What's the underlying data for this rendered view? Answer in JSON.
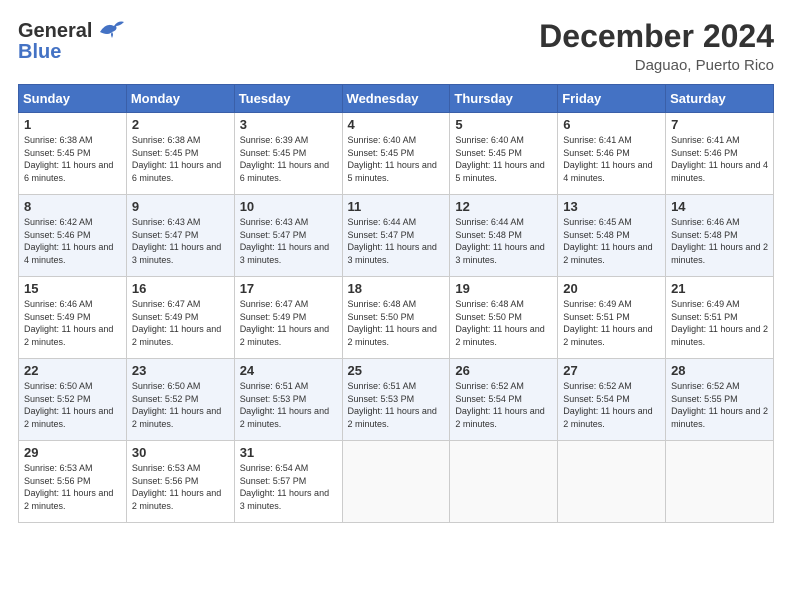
{
  "header": {
    "logo_general": "General",
    "logo_blue": "Blue",
    "month": "December 2024",
    "location": "Daguao, Puerto Rico"
  },
  "days_of_week": [
    "Sunday",
    "Monday",
    "Tuesday",
    "Wednesday",
    "Thursday",
    "Friday",
    "Saturday"
  ],
  "weeks": [
    [
      {
        "day": "1",
        "sunrise": "Sunrise: 6:38 AM",
        "sunset": "Sunset: 5:45 PM",
        "daylight": "Daylight: 11 hours and 6 minutes."
      },
      {
        "day": "2",
        "sunrise": "Sunrise: 6:38 AM",
        "sunset": "Sunset: 5:45 PM",
        "daylight": "Daylight: 11 hours and 6 minutes."
      },
      {
        "day": "3",
        "sunrise": "Sunrise: 6:39 AM",
        "sunset": "Sunset: 5:45 PM",
        "daylight": "Daylight: 11 hours and 6 minutes."
      },
      {
        "day": "4",
        "sunrise": "Sunrise: 6:40 AM",
        "sunset": "Sunset: 5:45 PM",
        "daylight": "Daylight: 11 hours and 5 minutes."
      },
      {
        "day": "5",
        "sunrise": "Sunrise: 6:40 AM",
        "sunset": "Sunset: 5:45 PM",
        "daylight": "Daylight: 11 hours and 5 minutes."
      },
      {
        "day": "6",
        "sunrise": "Sunrise: 6:41 AM",
        "sunset": "Sunset: 5:46 PM",
        "daylight": "Daylight: 11 hours and 4 minutes."
      },
      {
        "day": "7",
        "sunrise": "Sunrise: 6:41 AM",
        "sunset": "Sunset: 5:46 PM",
        "daylight": "Daylight: 11 hours and 4 minutes."
      }
    ],
    [
      {
        "day": "8",
        "sunrise": "Sunrise: 6:42 AM",
        "sunset": "Sunset: 5:46 PM",
        "daylight": "Daylight: 11 hours and 4 minutes."
      },
      {
        "day": "9",
        "sunrise": "Sunrise: 6:43 AM",
        "sunset": "Sunset: 5:47 PM",
        "daylight": "Daylight: 11 hours and 3 minutes."
      },
      {
        "day": "10",
        "sunrise": "Sunrise: 6:43 AM",
        "sunset": "Sunset: 5:47 PM",
        "daylight": "Daylight: 11 hours and 3 minutes."
      },
      {
        "day": "11",
        "sunrise": "Sunrise: 6:44 AM",
        "sunset": "Sunset: 5:47 PM",
        "daylight": "Daylight: 11 hours and 3 minutes."
      },
      {
        "day": "12",
        "sunrise": "Sunrise: 6:44 AM",
        "sunset": "Sunset: 5:48 PM",
        "daylight": "Daylight: 11 hours and 3 minutes."
      },
      {
        "day": "13",
        "sunrise": "Sunrise: 6:45 AM",
        "sunset": "Sunset: 5:48 PM",
        "daylight": "Daylight: 11 hours and 2 minutes."
      },
      {
        "day": "14",
        "sunrise": "Sunrise: 6:46 AM",
        "sunset": "Sunset: 5:48 PM",
        "daylight": "Daylight: 11 hours and 2 minutes."
      }
    ],
    [
      {
        "day": "15",
        "sunrise": "Sunrise: 6:46 AM",
        "sunset": "Sunset: 5:49 PM",
        "daylight": "Daylight: 11 hours and 2 minutes."
      },
      {
        "day": "16",
        "sunrise": "Sunrise: 6:47 AM",
        "sunset": "Sunset: 5:49 PM",
        "daylight": "Daylight: 11 hours and 2 minutes."
      },
      {
        "day": "17",
        "sunrise": "Sunrise: 6:47 AM",
        "sunset": "Sunset: 5:49 PM",
        "daylight": "Daylight: 11 hours and 2 minutes."
      },
      {
        "day": "18",
        "sunrise": "Sunrise: 6:48 AM",
        "sunset": "Sunset: 5:50 PM",
        "daylight": "Daylight: 11 hours and 2 minutes."
      },
      {
        "day": "19",
        "sunrise": "Sunrise: 6:48 AM",
        "sunset": "Sunset: 5:50 PM",
        "daylight": "Daylight: 11 hours and 2 minutes."
      },
      {
        "day": "20",
        "sunrise": "Sunrise: 6:49 AM",
        "sunset": "Sunset: 5:51 PM",
        "daylight": "Daylight: 11 hours and 2 minutes."
      },
      {
        "day": "21",
        "sunrise": "Sunrise: 6:49 AM",
        "sunset": "Sunset: 5:51 PM",
        "daylight": "Daylight: 11 hours and 2 minutes."
      }
    ],
    [
      {
        "day": "22",
        "sunrise": "Sunrise: 6:50 AM",
        "sunset": "Sunset: 5:52 PM",
        "daylight": "Daylight: 11 hours and 2 minutes."
      },
      {
        "day": "23",
        "sunrise": "Sunrise: 6:50 AM",
        "sunset": "Sunset: 5:52 PM",
        "daylight": "Daylight: 11 hours and 2 minutes."
      },
      {
        "day": "24",
        "sunrise": "Sunrise: 6:51 AM",
        "sunset": "Sunset: 5:53 PM",
        "daylight": "Daylight: 11 hours and 2 minutes."
      },
      {
        "day": "25",
        "sunrise": "Sunrise: 6:51 AM",
        "sunset": "Sunset: 5:53 PM",
        "daylight": "Daylight: 11 hours and 2 minutes."
      },
      {
        "day": "26",
        "sunrise": "Sunrise: 6:52 AM",
        "sunset": "Sunset: 5:54 PM",
        "daylight": "Daylight: 11 hours and 2 minutes."
      },
      {
        "day": "27",
        "sunrise": "Sunrise: 6:52 AM",
        "sunset": "Sunset: 5:54 PM",
        "daylight": "Daylight: 11 hours and 2 minutes."
      },
      {
        "day": "28",
        "sunrise": "Sunrise: 6:52 AM",
        "sunset": "Sunset: 5:55 PM",
        "daylight": "Daylight: 11 hours and 2 minutes."
      }
    ],
    [
      {
        "day": "29",
        "sunrise": "Sunrise: 6:53 AM",
        "sunset": "Sunset: 5:56 PM",
        "daylight": "Daylight: 11 hours and 2 minutes."
      },
      {
        "day": "30",
        "sunrise": "Sunrise: 6:53 AM",
        "sunset": "Sunset: 5:56 PM",
        "daylight": "Daylight: 11 hours and 2 minutes."
      },
      {
        "day": "31",
        "sunrise": "Sunrise: 6:54 AM",
        "sunset": "Sunset: 5:57 PM",
        "daylight": "Daylight: 11 hours and 3 minutes."
      },
      {
        "day": "",
        "sunrise": "",
        "sunset": "",
        "daylight": ""
      },
      {
        "day": "",
        "sunrise": "",
        "sunset": "",
        "daylight": ""
      },
      {
        "day": "",
        "sunrise": "",
        "sunset": "",
        "daylight": ""
      },
      {
        "day": "",
        "sunrise": "",
        "sunset": "",
        "daylight": ""
      }
    ]
  ]
}
